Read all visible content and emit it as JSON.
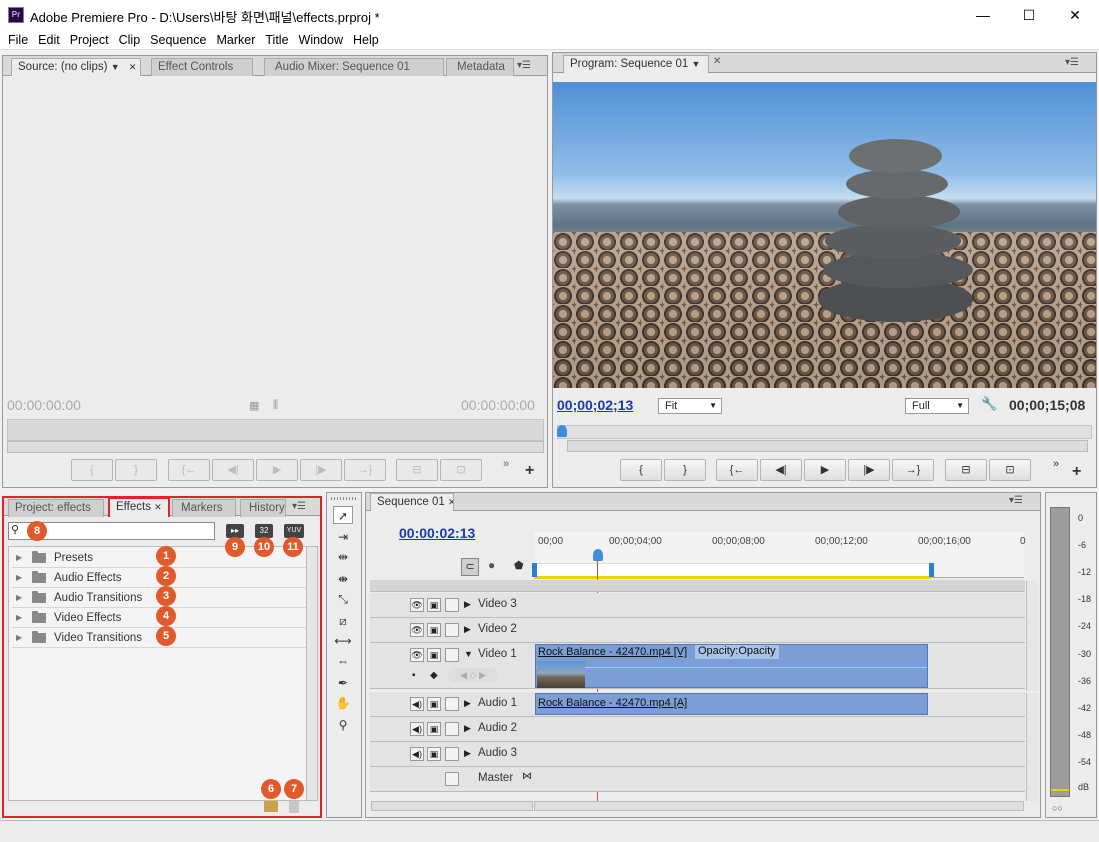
{
  "window": {
    "title": "Adobe Premiere Pro - D:\\Users\\바탕 화면\\패널\\effects.prproj *",
    "icon_label": "Pr",
    "minimize": "—",
    "maximize": "☐",
    "close": "✕"
  },
  "menu": [
    "File",
    "Edit",
    "Project",
    "Clip",
    "Sequence",
    "Marker",
    "Title",
    "Window",
    "Help"
  ],
  "source_panel": {
    "tabs": [
      "Source: (no clips)",
      "Effect Controls",
      "Audio Mixer: Sequence 01",
      "Metadata"
    ],
    "timecode_in": "00:00:00:00",
    "timecode_out": "00:00:00:00",
    "buttons": [
      "{",
      "}",
      "{←",
      "◀|",
      "▶",
      "|▶",
      "→}",
      "⊟",
      "⊡"
    ]
  },
  "program_panel": {
    "tab": "Program: Sequence 01",
    "timecode": "00;00;02;13",
    "duration": "00;00;15;08",
    "zoom": "Fit",
    "quality": "Full",
    "buttons": [
      "{",
      "}",
      "{←",
      "◀|",
      "▶",
      "|▶",
      "→}",
      "⊟",
      "⊡"
    ]
  },
  "project_panel": {
    "tabs": [
      "Project: effects",
      "Effects",
      "Markers",
      "History"
    ],
    "search_value": "",
    "icon_labels": [
      "32",
      "YUV"
    ],
    "folders": [
      "Presets",
      "Audio Effects",
      "Audio Transitions",
      "Video Effects",
      "Video Transitions"
    ],
    "badges": [
      "1",
      "2",
      "3",
      "4",
      "5",
      "6",
      "7",
      "8",
      "9",
      "10",
      "11"
    ]
  },
  "timeline": {
    "tab": "Sequence 01",
    "timecode": "00:00:02:13",
    "ruler": [
      "00;00",
      "00;00;04;00",
      "00;00;08;00",
      "00;00;12;00",
      "00;00;16;00",
      "0"
    ],
    "tracks": [
      "Video 3",
      "Video 2",
      "Video 1",
      "Audio 1",
      "Audio 2",
      "Audio 3",
      "Master"
    ],
    "video_clip": "Rock Balance - 42470.mp4 [V]",
    "opacity_label": "Opacity:Opacity",
    "audio_clip": "Rock Balance - 42470.mp4 [A]"
  },
  "meter": {
    "labels": [
      "0",
      "-6",
      "-12",
      "-18",
      "-24",
      "-30",
      "-36",
      "-42",
      "-48",
      "-54",
      "dB"
    ]
  },
  "colors": {
    "accent_red": "#e0222b",
    "badge": "#e05a2b",
    "clip_blue": "#7b9fd4",
    "timecode_blue": "#1a3ca8",
    "playhead": "#e04a2a"
  }
}
